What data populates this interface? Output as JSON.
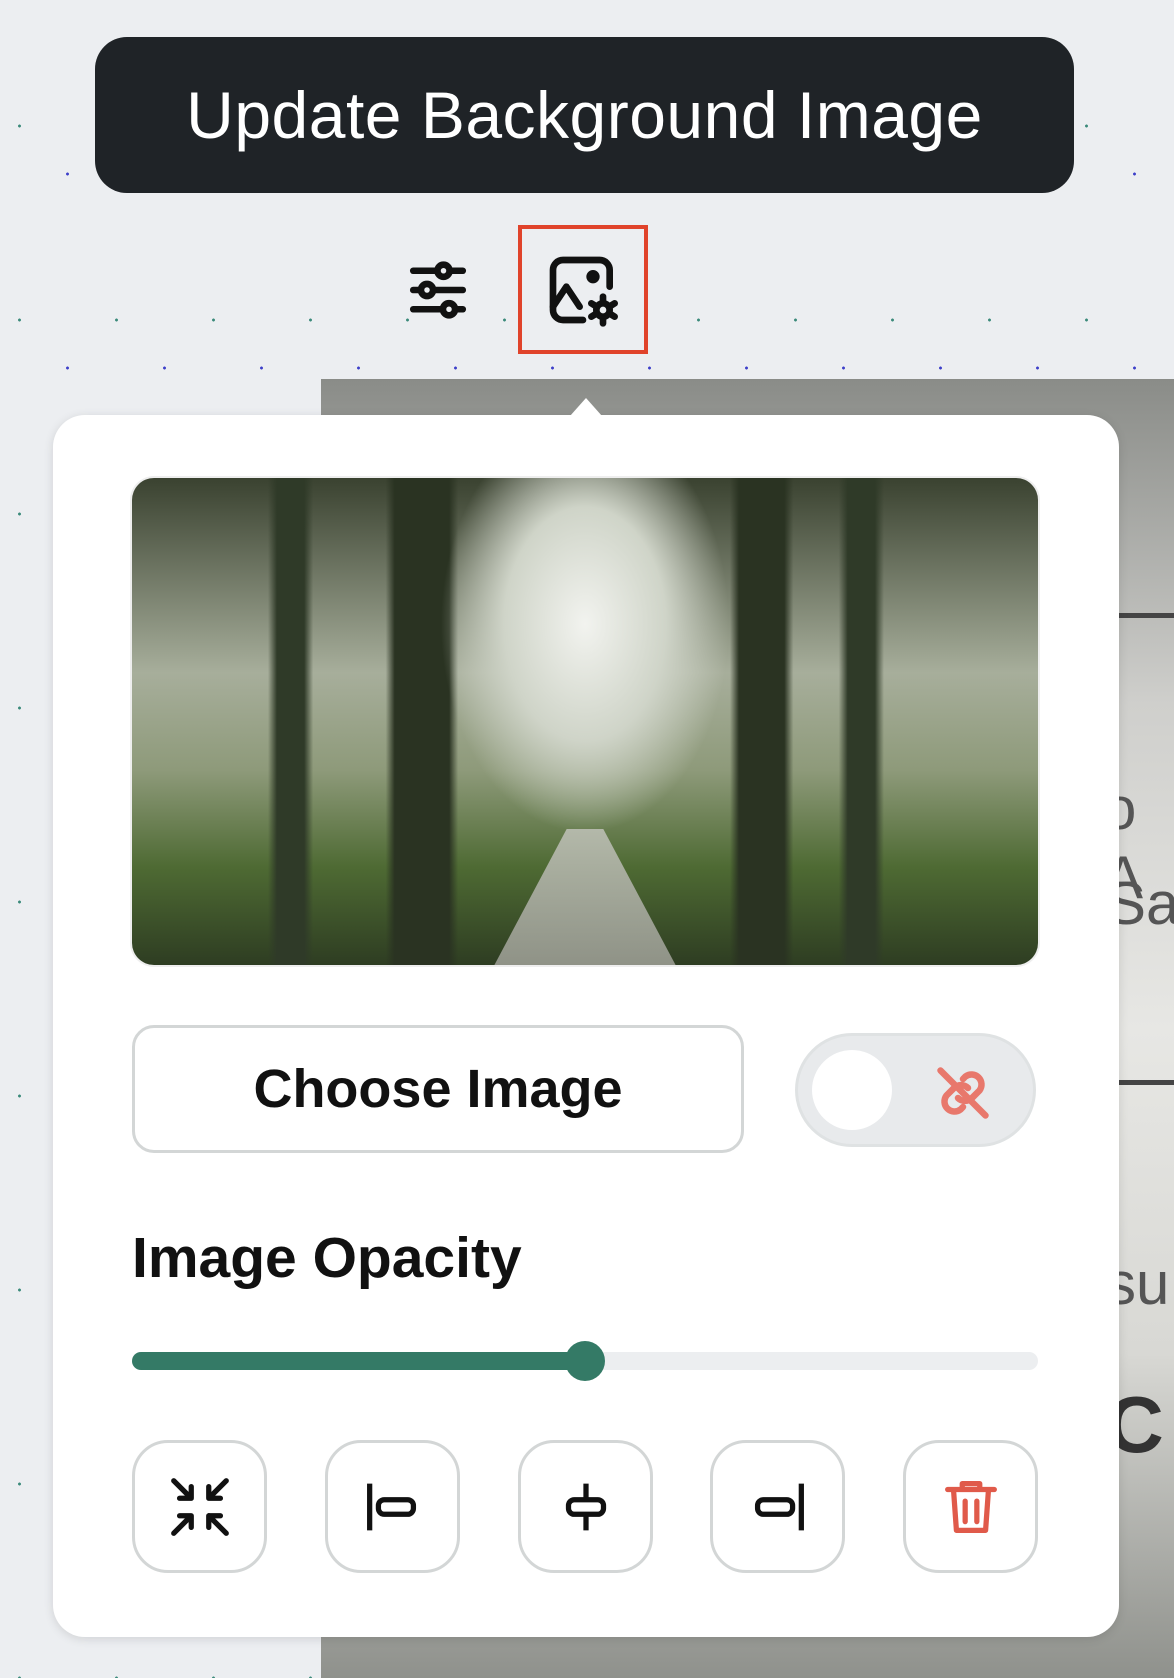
{
  "tooltip": {
    "text": "Update Background Image"
  },
  "toolbar": {
    "items": [
      {
        "icon": "sliders-icon"
      },
      {
        "icon": "image-settings-icon",
        "highlighted": true,
        "highlight_color": "#e0432b"
      }
    ]
  },
  "background_fragments": [
    "o A",
    "Sa",
    "su",
    "C"
  ],
  "popover": {
    "preview_alt": "misty forest ruins with arches",
    "choose_image_label": "Choose Image",
    "link_toggle": {
      "on": false,
      "icon": "unlink-icon",
      "icon_color": "#e8786c"
    },
    "opacity_label": "Image Opacity",
    "opacity_value": 0.5,
    "accent_color": "#347a66",
    "tools": [
      {
        "name": "fit-button",
        "icon": "collapse-arrows-icon"
      },
      {
        "name": "align-left-button",
        "icon": "align-left-icon"
      },
      {
        "name": "align-center-button",
        "icon": "align-center-icon"
      },
      {
        "name": "align-right-button",
        "icon": "align-right-icon"
      },
      {
        "name": "delete-button",
        "icon": "trash-icon",
        "color": "#e05a4a"
      }
    ]
  }
}
